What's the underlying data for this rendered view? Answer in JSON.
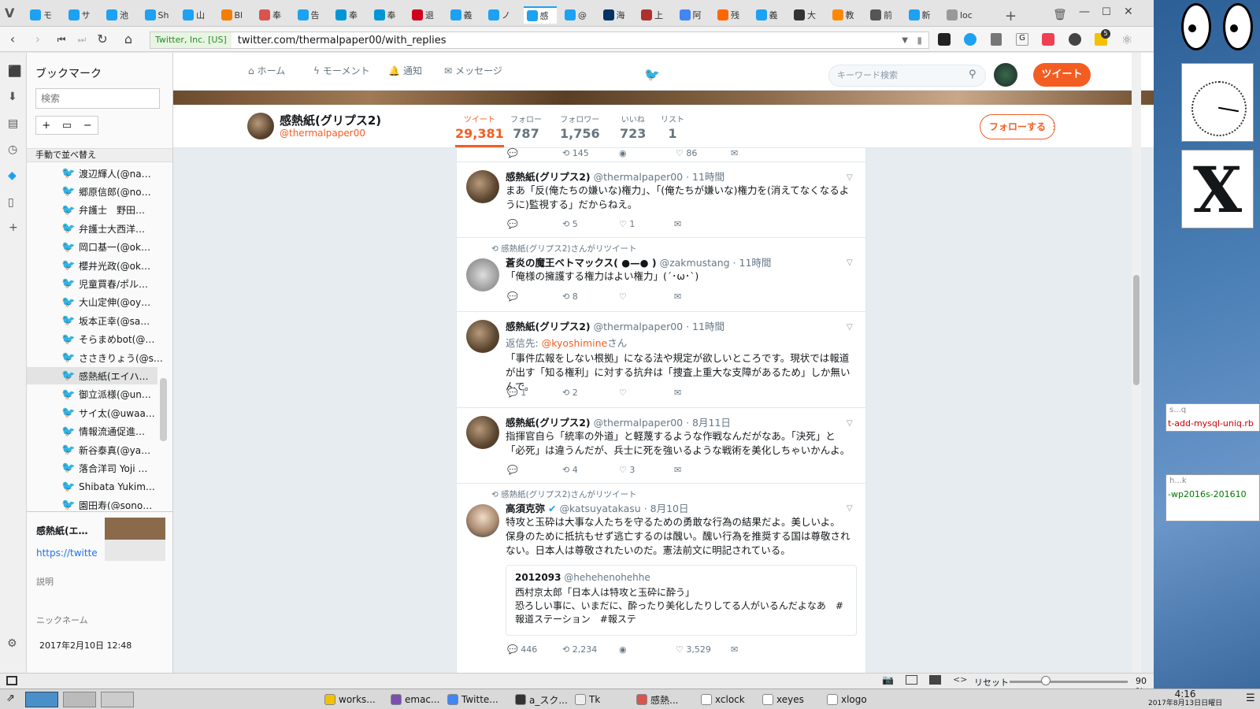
{
  "browser": {
    "tabs": [
      "モ",
      "サ",
      "池",
      "Sh",
      "山",
      "Bl",
      "奉",
      "告",
      "奉",
      "奉",
      "退",
      "義",
      "ノ",
      "感",
      "@",
      "海",
      "上",
      "阿",
      "残",
      "義",
      "大",
      "教",
      "前",
      "新",
      "loc"
    ],
    "tab_colors": [
      "#1da1f2",
      "#1da1f2",
      "#1da1f2",
      "#1da1f2",
      "#1da1f2",
      "#f57d00",
      "#d9534f",
      "#1da1f2",
      "#0096d6",
      "#0096d6",
      "#d0021b",
      "#1da1f2",
      "#1da1f2",
      "#1da1f2",
      "#1da1f2",
      "#003366",
      "#b03030",
      "#4285f4",
      "#ff6600",
      "#1da1f2",
      "#333333",
      "#ff8800",
      "#555555",
      "#1da1f2",
      "#999999"
    ],
    "cert": "Twitter, Inc. [US]",
    "url": "twitter.com/thermalpaper00/with_replies",
    "ext_badge": "5"
  },
  "bookmarks": {
    "title": "ブックマーク",
    "search_placeholder": "検索",
    "sort_label": "手動で並べ替え",
    "items": [
      "渡辺輝人(@na…",
      "郷原信郎(@no…",
      "弁護士　野田…",
      "弁護士大西洋…",
      "岡口基一(@ok…",
      "櫻井光政(@ok…",
      "児童買春/ポル…",
      "大山定伸(@oy…",
      "坂本正幸(@sa…",
      "そらまめbot(@…",
      "ささきりょう(@s…",
      "感熱紙(エイハ…",
      "御立派様(@un…",
      "サイ太(@uwaa…",
      "情報流通促進…",
      "新谷泰真(@ya…",
      "落合洋司 Yoji …",
      "Shibata Yukim…",
      "園田寿(@sono…"
    ],
    "preview_title": "感熱紙(エ…",
    "preview_url": "https://twitte",
    "desc_label": "説明",
    "nick_label": "ニックネーム",
    "date": "2017年2月10日 12:48"
  },
  "twitter": {
    "nav": {
      "home": "ホーム",
      "moments": "モーメント",
      "notifications": "通知",
      "messages": "メッセージ"
    },
    "search_placeholder": "キーワード検索",
    "tweet_button": "ツイート",
    "profile": {
      "name": "感熱紙(グリプス2)",
      "handle": "@thermalpaper00"
    },
    "stats": [
      {
        "label": "ツイート",
        "value": "29,381"
      },
      {
        "label": "フォロー",
        "value": "787"
      },
      {
        "label": "フォロワー",
        "value": "1,756"
      },
      {
        "label": "いいね",
        "value": "723"
      },
      {
        "label": "リスト",
        "value": "1"
      }
    ],
    "follow_button": "フォローする",
    "top_counts": {
      "rt": "145",
      "like": "86"
    },
    "tweets": [
      {
        "name": "感熱紙(グリプス2)",
        "handle": "@thermalpaper00",
        "time": "· 11時間",
        "text": "まあ「反(俺たちの嫌いな)権力」、「(俺たちが嫌いな)権力を(消えてなくなるように)監視する」だからねえ。",
        "reply": "",
        "rt": "5",
        "like": "1"
      },
      {
        "retweeted_by": "感熱紙(グリプス2)さんがリツイート",
        "name": "蒼炎の魔王ベトマックス( ●—● )",
        "handle": "@zakmustang",
        "time": "· 11時間",
        "text": "「俺様の擁護する権力はよい権力」(´･ω･`)",
        "reply": "",
        "rt": "8",
        "like": ""
      },
      {
        "name": "感熱紙(グリプス2)",
        "handle": "@thermalpaper00",
        "time": "· 11時間",
        "reply_to_label": "返信先:",
        "reply_to": "@kyoshimine",
        "reply_to_suffix": "さん",
        "text": "「事件広報をしない根拠」になる法や規定が欲しいところです。現状では報道が出す「知る権利」に対する抗弁は「捜査上重大な支障があるため」しか無いんで。",
        "reply": "1",
        "rt": "2",
        "like": ""
      },
      {
        "name": "感熱紙(グリプス2)",
        "handle": "@thermalpaper00",
        "time": "· 8月11日",
        "text": "指揮官自ら「統率の外道」と軽蔑するような作戦なんだがなあ。「決死」と「必死」は違うんだが、兵士に死を強いるような戦術を美化しちゃいかんよ。",
        "reply": "",
        "rt": "4",
        "like": "3"
      },
      {
        "retweeted_by": "感熱紙(グリプス2)さんがリツイート",
        "name": "高須克弥",
        "handle": "@katsuyatakasu",
        "time": "· 8月10日",
        "text": "特攻と玉砕は大事な人たちを守るための勇敢な行為の結果だよ。美しいよ。\n保身のために抵抗もせず逃亡するのは醜い。醜い行為を推奨する国は尊敬されない。日本人は尊敬されたいのだ。憲法前文に明記されている。",
        "quote_name": "2012093",
        "quote_handle": "@hehehenohehhe",
        "quote_text": "西村京太郎「日本人は特攻と玉砕に酔う」\n恐ろしい事に、いまだに、酔ったり美化したりしてる人がいるんだよなあ　#報道ステーション　#報ステ",
        "reply": "446",
        "rt": "2,234",
        "like": "3,529"
      }
    ]
  },
  "statusbar": {
    "reset": "リセット",
    "zoom": "90 %"
  },
  "taskbar": {
    "items": [
      "works...",
      "emac...",
      "Twitte...",
      "a_スク...",
      "Tk",
      "感熱...",
      "xclock",
      "xeyes",
      "xlogo"
    ],
    "clock_time": "4:16",
    "clock_date": "2017年8月13日日曜日"
  },
  "desktop": {
    "win1": "s...q",
    "win1_text": "t-add-mysql-uniq.rb",
    "win2": "h...k",
    "win2_text": "-wp2016s-201610"
  }
}
